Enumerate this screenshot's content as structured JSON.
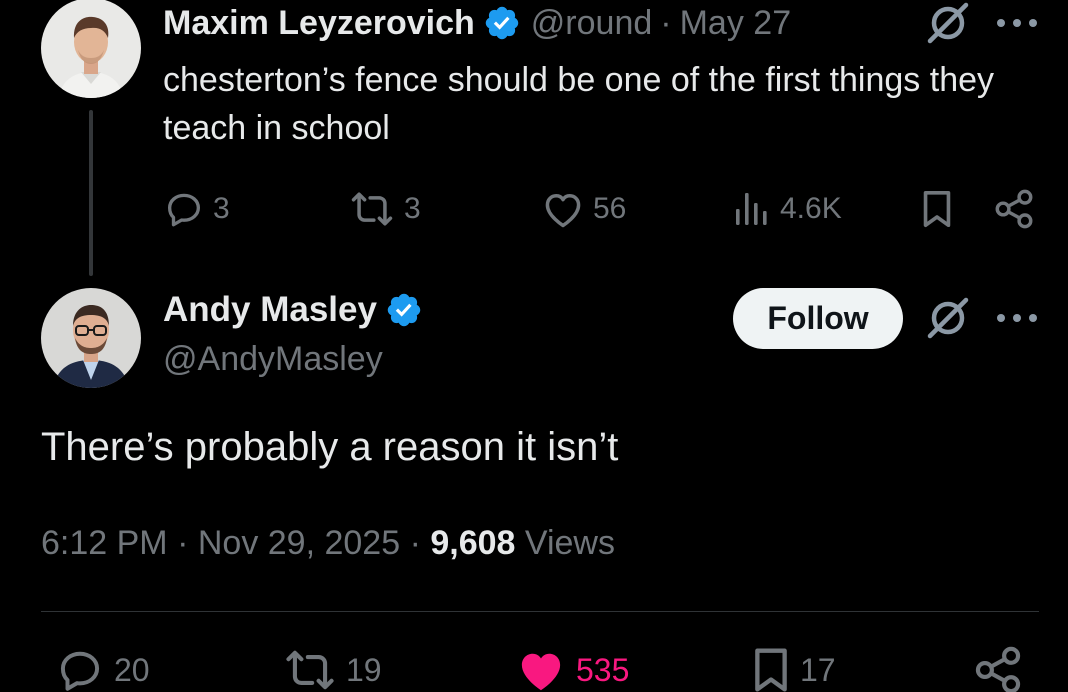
{
  "parent_tweet": {
    "author_name": "Maxim Leyzerovich",
    "handle": "@round",
    "separator": "·",
    "date": "May 27",
    "text": "chesterton’s fence should be one of the first things they teach in school",
    "stats": {
      "replies": "3",
      "reposts": "3",
      "likes": "56",
      "views": "4.6K"
    }
  },
  "main_tweet": {
    "author_name": "Andy Masley",
    "handle": "@AndyMasley",
    "follow_label": "Follow",
    "text": "There’s probably a reason it isn’t",
    "time": "6:12 PM",
    "separator": "·",
    "date": "Nov 29, 2025",
    "views_count": "9,608",
    "views_label": "Views",
    "stats": {
      "replies": "20",
      "reposts": "19",
      "likes": "535",
      "bookmarks": "17"
    }
  },
  "colors": {
    "background": "#000000",
    "text_primary": "#e7e9ea",
    "text_secondary": "#71767b",
    "verified_blue": "#1d9bf0",
    "like_pink": "#f91880",
    "follow_bg": "#eff3f4"
  },
  "icons": {
    "verified": "verified-badge-icon",
    "grok": "grok-icon",
    "more": "more-icon",
    "reply": "reply-icon",
    "repost": "repost-icon",
    "like": "like-icon",
    "views": "views-icon",
    "bookmark": "bookmark-icon",
    "share": "share-icon"
  }
}
